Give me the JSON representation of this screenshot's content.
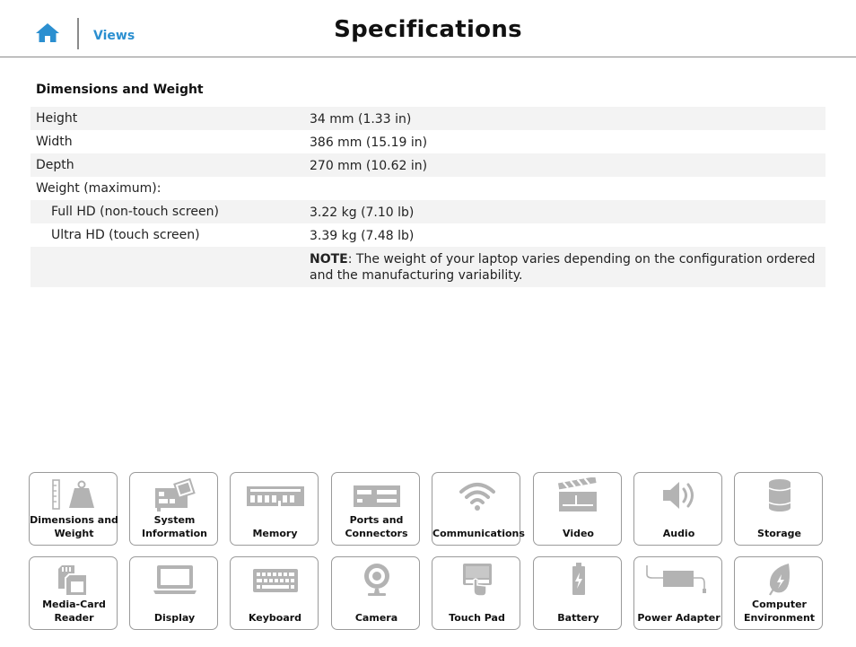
{
  "header": {
    "home_icon": "home-icon",
    "views_label": "Views",
    "title": "Specifications"
  },
  "section": {
    "title": "Dimensions and Weight",
    "rows": [
      {
        "label": "Height",
        "value": "34 mm (1.33 in)"
      },
      {
        "label": "Width",
        "value": "386 mm (15.19 in)"
      },
      {
        "label": "Depth",
        "value": "270 mm (10.62 in)"
      },
      {
        "label": "Weight (maximum):",
        "value": ""
      },
      {
        "label": "Full HD (non-touch screen)",
        "value": "3.22 kg (7.10 lb)"
      },
      {
        "label": "Ultra HD (touch screen)",
        "value": "3.39 kg (7.48 lb)"
      }
    ],
    "note": {
      "prefix": "NOTE",
      "text": ": The weight of your laptop varies depending on the configuration ordered and the manufacturing variability."
    }
  },
  "tiles": [
    {
      "line1": "Dimensions and",
      "line2": "Weight",
      "icon": "dimensions-weight-icon"
    },
    {
      "line1": "System",
      "line2": "Information",
      "icon": "system-information-icon"
    },
    {
      "line1": "Memory",
      "line2": "",
      "icon": "memory-icon"
    },
    {
      "line1": "Ports and",
      "line2": "Connectors",
      "icon": "ports-connectors-icon"
    },
    {
      "line1": "Communications",
      "line2": "",
      "icon": "wifi-icon"
    },
    {
      "line1": "Video",
      "line2": "",
      "icon": "video-clapperboard-icon"
    },
    {
      "line1": "Audio",
      "line2": "",
      "icon": "speaker-icon"
    },
    {
      "line1": "Storage",
      "line2": "",
      "icon": "storage-drive-icon"
    },
    {
      "line1": "Media-Card",
      "line2": "Reader",
      "icon": "media-card-icon"
    },
    {
      "line1": "Display",
      "line2": "",
      "icon": "display-laptop-icon"
    },
    {
      "line1": "Keyboard",
      "line2": "",
      "icon": "keyboard-icon"
    },
    {
      "line1": "Camera",
      "line2": "",
      "icon": "camera-icon"
    },
    {
      "line1": "Touch Pad",
      "line2": "",
      "icon": "touch-pad-icon"
    },
    {
      "line1": "Battery",
      "line2": "",
      "icon": "battery-icon"
    },
    {
      "line1": "Power Adapter",
      "line2": "",
      "icon": "power-adapter-icon"
    },
    {
      "line1": "Computer",
      "line2": "Environment",
      "icon": "environment-leaf-icon"
    }
  ],
  "colors": {
    "accent": "#2b8fd0",
    "icon_gray": "#b3b3b3",
    "row_shade": "#f3f3f3"
  }
}
